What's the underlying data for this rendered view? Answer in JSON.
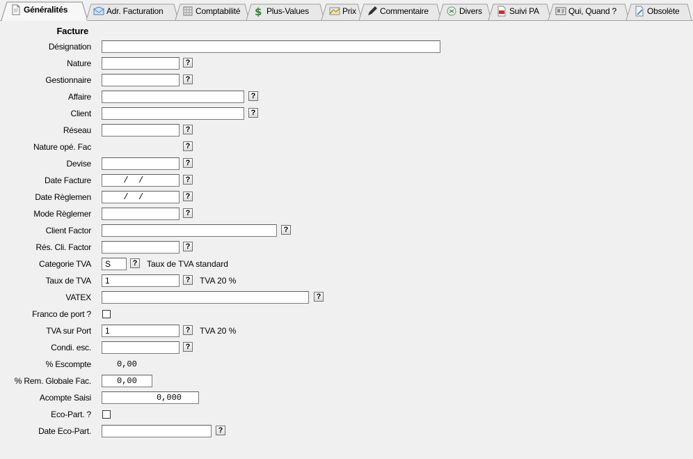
{
  "tabs": [
    {
      "label": "Généralités",
      "icon": "document-icon",
      "active": true
    },
    {
      "label": "Adr. Facturation",
      "icon": "envelope-icon"
    },
    {
      "label": "Comptabilité",
      "icon": "ledger-icon"
    },
    {
      "label": "Plus-Values",
      "icon": "dollar-icon"
    },
    {
      "label": "Prix",
      "icon": "price-icon"
    },
    {
      "label": "Commentaire",
      "icon": "pencil-icon"
    },
    {
      "label": "Divers",
      "icon": "misc-icon"
    },
    {
      "label": "Suivi PA",
      "icon": "pdf-icon"
    },
    {
      "label": "Qui, Quand ?",
      "icon": "id-card-icon"
    },
    {
      "label": "Obsolète",
      "icon": "obsolete-icon"
    }
  ],
  "form": {
    "section_title": "Facture",
    "designation": {
      "label": "Désignation",
      "value": ""
    },
    "nature": {
      "label": "Nature",
      "value": ""
    },
    "gestionnaire": {
      "label": "Gestionnaire",
      "value": ""
    },
    "affaire": {
      "label": "Affaire",
      "value": ""
    },
    "client": {
      "label": "Client",
      "value": ""
    },
    "reseau": {
      "label": "Réseau",
      "value": ""
    },
    "nature_ope_fac": {
      "label": "Nature opé. Fac"
    },
    "devise": {
      "label": "Devise",
      "value": ""
    },
    "date_facture": {
      "label": "Date Facture",
      "value": "  /  /"
    },
    "date_reglement": {
      "label": "Date Règlemen",
      "value": "  /  /"
    },
    "mode_reglement": {
      "label": "Mode Règlemer",
      "value": ""
    },
    "client_factor": {
      "label": "Client Factor",
      "value": ""
    },
    "res_cli_factor": {
      "label": "Rés. Cli. Factor",
      "value": ""
    },
    "categorie_tva": {
      "label": "Categorie TVA",
      "value": "S",
      "description": "Taux de TVA standard"
    },
    "taux_tva": {
      "label": "Taux de TVA",
      "value": "1",
      "description": "TVA 20 %"
    },
    "vatex": {
      "label": "VATEX",
      "value": ""
    },
    "franco_port": {
      "label": "Franco de port ?",
      "checked": false
    },
    "tva_port": {
      "label": "TVA sur Port",
      "value": "1",
      "description": "TVA 20 %"
    },
    "condi_esc": {
      "label": "Condi. esc.",
      "value": ""
    },
    "escompte": {
      "label": "% Escompte",
      "value": "0,00"
    },
    "rem_globale": {
      "label": "% Rem. Globale Fac.",
      "value": "0,00"
    },
    "acompte": {
      "label": "Acompte Saisi",
      "value": "0,000"
    },
    "eco_part": {
      "label": "Eco-Part. ?",
      "checked": false
    },
    "date_eco_part": {
      "label": "Date Eco-Part.",
      "value": ""
    },
    "lookup_label": "?"
  }
}
